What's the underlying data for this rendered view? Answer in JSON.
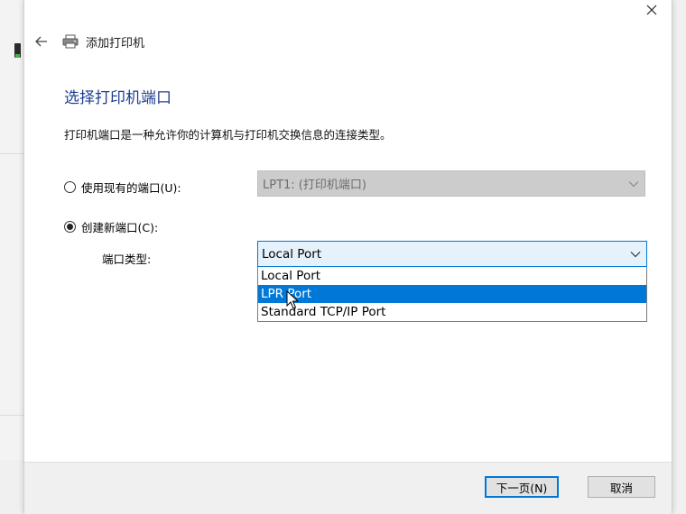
{
  "dialog": {
    "title": "添加打印机",
    "close_symbol": "✕"
  },
  "page": {
    "heading": "选择打印机端口",
    "description": "打印机端口是一种允许你的计算机与打印机交换信息的连接类型。"
  },
  "existing_port": {
    "label": "使用现有的端口(U):",
    "selected": false,
    "value": "LPT1: (打印机端口)"
  },
  "new_port": {
    "label": "创建新端口(C):",
    "selected": true,
    "type_label": "端口类型:",
    "value": "Local Port",
    "options": [
      "Local Port",
      "LPR Port",
      "Standard TCP/IP Port"
    ],
    "highlighted_option": "LPR Port"
  },
  "footer": {
    "next_label": "下一页(N)",
    "cancel_label": "取消"
  },
  "colors": {
    "heading": "#1f3e93",
    "accent": "#0078d7"
  },
  "icons": [
    "close-icon",
    "back-arrow-icon",
    "printer-icon",
    "chevron-down-icon",
    "mouse-cursor-icon"
  ]
}
